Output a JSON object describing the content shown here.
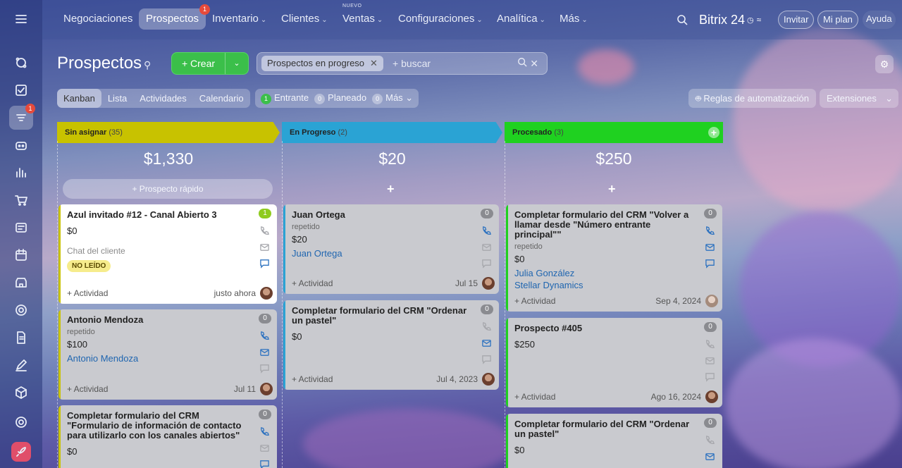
{
  "nav": {
    "menu_icon": "hamburger-icon",
    "items": [
      {
        "label": "Negociaciones",
        "chevron": false
      },
      {
        "label": "Prospectos",
        "chevron": false,
        "badge": "1",
        "selected": true
      },
      {
        "label": "Inventario",
        "chevron": true
      },
      {
        "label": "Clientes",
        "chevron": true
      },
      {
        "label": "Ventas",
        "chevron": true,
        "tag": "NUEVO"
      },
      {
        "label": "Configuraciones",
        "chevron": true
      },
      {
        "label": "Analítica",
        "chevron": true
      },
      {
        "label": "Más",
        "chevron": true
      }
    ],
    "brand": "Bitrix 24",
    "invite": "Invitar",
    "plan": "Mi plan",
    "help": "Ayuda"
  },
  "rail": {
    "icons": [
      "hamburger-icon",
      "feed-icon",
      "tasks-icon",
      "crm-icon",
      "robot-icon",
      "analytics-icon",
      "cart-icon",
      "inventory-icon",
      "calendar-icon",
      "store-icon",
      "target-icon",
      "document-icon",
      "sign-icon",
      "box-icon",
      "settings-icon",
      "rocket-icon"
    ],
    "crm_badge": "1"
  },
  "page": {
    "title": "Prospectos",
    "create": "+ Crear",
    "filter_chip": "Prospectos en progreso",
    "search_placeholder": "+ buscar"
  },
  "views": [
    "Kanban",
    "Lista",
    "Actividades",
    "Calendario"
  ],
  "counters": [
    {
      "count": "1",
      "label": "Entrante"
    },
    {
      "count": "0",
      "label": "Planeado"
    },
    {
      "count": "0",
      "label": "Más"
    }
  ],
  "automation": "Reglas de automatización",
  "extensions": "Extensiones",
  "columns": [
    {
      "title": "Sin asignar",
      "count": "(35)",
      "sum": "$1,330",
      "color": "#c8c200",
      "quick": "+ Prospecto rápido"
    },
    {
      "title": "En Progreso",
      "count": "(2)",
      "sum": "$20",
      "color": "#2aa3d4"
    },
    {
      "title": "Procesado",
      "count": "(3)",
      "sum": "$250",
      "color": "#1fd120"
    }
  ],
  "cards": {
    "c1": {
      "title": "Azul invitado #12 - Canal Abierto 3",
      "amount": "$0",
      "source": "Chat del cliente",
      "tag": "NO LEÍDO",
      "badge": "1",
      "add": "+ Actividad",
      "time": "justo ahora"
    },
    "c2": {
      "title": "Antonio Mendoza",
      "sub": "repetido",
      "amount": "$100",
      "contact": "Antonio Mendoza",
      "badge": "0",
      "add": "+ Actividad",
      "time": "Jul 11"
    },
    "c3": {
      "title": "Completar formulario del CRM \"Formulario de información de contacto para utilizarlo con los canales abiertos\"",
      "amount": "$0",
      "badge": "0"
    },
    "c4": {
      "title": "Juan Ortega",
      "sub": "repetido",
      "amount": "$20",
      "contact": "Juan Ortega",
      "badge": "0",
      "add": "+ Actividad",
      "time": "Jul 15"
    },
    "c5": {
      "title": "Completar formulario del CRM \"Ordenar un pastel\"",
      "amount": "$0",
      "badge": "0",
      "add": "+ Actividad",
      "time": "Jul 4, 2023"
    },
    "c6": {
      "title": "Completar formulario del CRM \"Volver a llamar desde \"Número entrante principal\"\"",
      "sub": "repetido",
      "amount": "$0",
      "contact": "Julia González",
      "company": "Stellar Dynamics",
      "badge": "0",
      "add": "+ Actividad",
      "time": "Sep 4, 2024"
    },
    "c7": {
      "title": "Prospecto #405",
      "amount": "$250",
      "badge": "0",
      "add": "+ Actividad",
      "time": "Ago 16, 2024"
    },
    "c8": {
      "title": "Completar formulario del CRM \"Ordenar un pastel\"",
      "amount": "$0",
      "badge": "0"
    }
  }
}
